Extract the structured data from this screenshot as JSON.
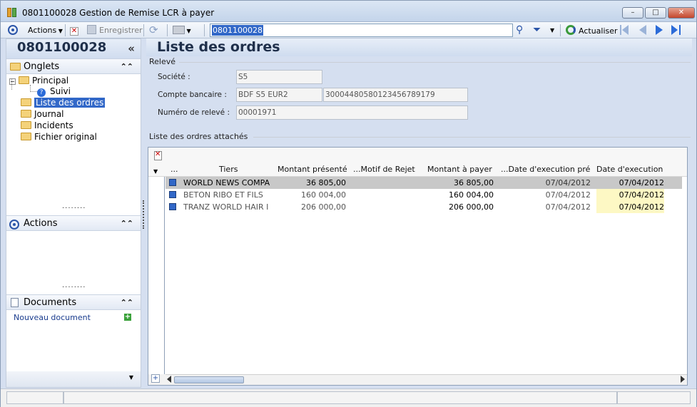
{
  "window": {
    "title": "0801100028  Gestion de Remise LCR à payer",
    "min_glyph": "–",
    "max_glyph": "□",
    "close_glyph": "✕"
  },
  "toolbar": {
    "actions_label": "Actions",
    "save_label": "Enregistrer",
    "search_value": "0801100028",
    "refresh_label": "Actualiser"
  },
  "left": {
    "header_title": "0801100028",
    "collapse_glyph": "«",
    "tabs_title": "Onglets",
    "tree": [
      {
        "label": "Principal"
      },
      {
        "label": "Suivi"
      },
      {
        "label": "Liste des ordres"
      },
      {
        "label": "Journal"
      },
      {
        "label": "Incidents"
      },
      {
        "label": "Fichier original"
      }
    ],
    "actions_title": "Actions",
    "documents_title": "Documents",
    "new_document_label": "Nouveau document",
    "expand_glyph": "⌃"
  },
  "main": {
    "title": "Liste des ordres",
    "group_releve": "Relevé",
    "societe_label": "Société :",
    "societe_value": "S5",
    "compte_label": "Compte bancaire :",
    "compte_code": "BDF S5 EUR2",
    "compte_number": "30004480580123456789179",
    "releve_label": "Numéro de relevé :",
    "releve_value": "00001971",
    "group_liste": "Liste des ordres attachés"
  },
  "grid": {
    "columns": [
      "...",
      "Tiers",
      "Montant présenté",
      "...Motif de Rejet",
      "Montant à payer",
      "...Date d'execution pré",
      "Date d'execution"
    ],
    "rows": [
      {
        "tiers": "WORLD NEWS COMPA",
        "montant_presente": "36 805,00",
        "motif": "",
        "montant_payer": "36 805,00",
        "date_prevue": "07/04/2012",
        "date_exec": "07/04/2012"
      },
      {
        "tiers": "BETON RIBO ET FILS",
        "montant_presente": "160 004,00",
        "motif": "",
        "montant_payer": "160 004,00",
        "date_prevue": "07/04/2012",
        "date_exec": "07/04/2012"
      },
      {
        "tiers": "TRANZ WORLD HAIR I",
        "montant_presente": "206 000,00",
        "motif": "",
        "montant_payer": "206 000,00",
        "date_prevue": "07/04/2012",
        "date_exec": "07/04/2012"
      }
    ]
  },
  "colors": {
    "selection": "#3268c8",
    "highlight_date": "#fdf8c4",
    "selected_row": "#c8c8c8"
  }
}
